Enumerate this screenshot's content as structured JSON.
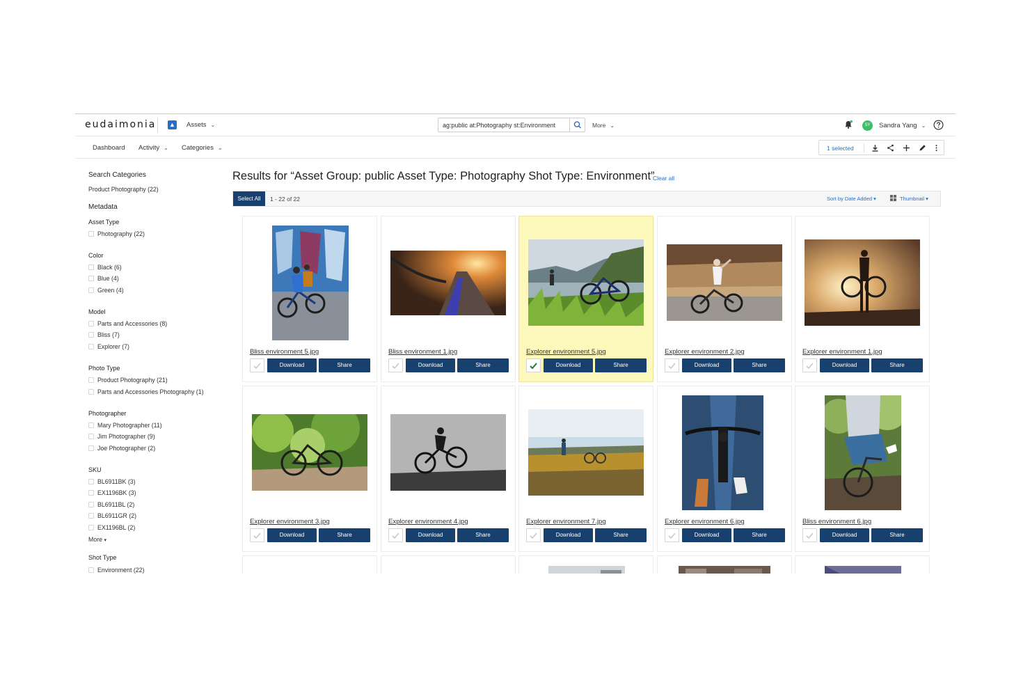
{
  "header": {
    "logo": "eudaimonia",
    "assets_label": "Assets",
    "search_value": "ag:public at:Photography st:Environment",
    "more_label": "More",
    "user_name": "Sandra Yang",
    "user_initials": "SY"
  },
  "subnav": {
    "items": [
      "Dashboard",
      "Activity",
      "Categories"
    ]
  },
  "selection": {
    "count_label": "1 selected"
  },
  "sidebar": {
    "search_categories_title": "Search Categories",
    "product_photography": "Product Photography (22)",
    "metadata_title": "Metadata",
    "groups": [
      {
        "title": "Asset Type",
        "options": [
          "Photography (22)"
        ]
      },
      {
        "title": "Color",
        "options": [
          "Black (6)",
          "Blue (4)",
          "Green (4)"
        ]
      },
      {
        "title": "Model",
        "options": [
          "Parts and Accessories (8)",
          "Bliss (7)",
          "Explorer (7)"
        ]
      },
      {
        "title": "Photo Type",
        "options": [
          "Product Photography (21)",
          "Parts and Accessories Photography (1)"
        ]
      },
      {
        "title": "Photographer",
        "options": [
          "Mary Photographer (11)",
          "Jim Photographer (9)",
          "Joe Photographer (2)"
        ]
      },
      {
        "title": "SKU",
        "options": [
          "BL6911BK (3)",
          "EX1196BK (3)",
          "BL6911BL (2)",
          "BL6911GR (2)",
          "EX1196BL (2)"
        ]
      },
      {
        "title": "Shot Type",
        "options": [
          "Environment (22)"
        ]
      }
    ],
    "more_label": "More"
  },
  "results": {
    "title": "Results for “Asset Group: public Asset Type: Photography Shot Type: Environment”",
    "clear_all": "Clear all",
    "select_all": "Select All",
    "range": "1 - 22 of 22",
    "sort_label": "Sort by Date Added",
    "view_label": "Thumbnail",
    "download_label": "Download",
    "share_label": "Share",
    "cards": [
      {
        "name": "Bliss environment 5.jpg",
        "selected": false
      },
      {
        "name": "Bliss environment 1.jpg",
        "selected": false
      },
      {
        "name": "Explorer environment 5.jpg",
        "selected": true
      },
      {
        "name": "Explorer environment 2.jpg",
        "selected": false
      },
      {
        "name": "Explorer environment 1.jpg",
        "selected": false
      },
      {
        "name": "Explorer environment 3.jpg",
        "selected": false
      },
      {
        "name": "Explorer environment 4.jpg",
        "selected": false
      },
      {
        "name": "Explorer environment 7.jpg",
        "selected": false
      },
      {
        "name": "Explorer environment 6.jpg",
        "selected": false
      },
      {
        "name": "Bliss environment 6.jpg",
        "selected": false
      }
    ]
  },
  "colors": {
    "primary_button": "#17406f",
    "link": "#2b6cc4",
    "highlight_card": "#fdf8bb",
    "avatar": "#3bbf6a",
    "check": "#1e7a3a"
  }
}
